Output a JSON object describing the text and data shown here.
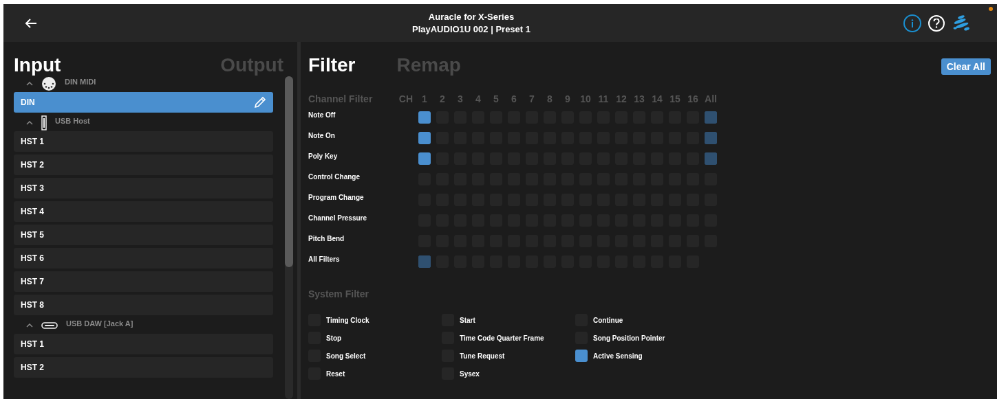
{
  "header": {
    "title": "Auracle for X-Series",
    "subtitle": "PlayAUDIO1U 002 | Preset 1",
    "notification_dot": true
  },
  "left_tabs": [
    {
      "label": "Input",
      "selected": true
    },
    {
      "label": "Output",
      "selected": false
    }
  ],
  "port_groups": [
    {
      "name": "DIN MIDI",
      "kind": "din",
      "expanded": true,
      "ports": [
        {
          "label": "DIN",
          "selected": true
        }
      ]
    },
    {
      "name": "USB Host",
      "kind": "usb_host",
      "expanded": true,
      "ports": [
        {
          "label": "HST 1",
          "selected": false
        },
        {
          "label": "HST 2",
          "selected": false
        },
        {
          "label": "HST 3",
          "selected": false
        },
        {
          "label": "HST 4",
          "selected": false
        },
        {
          "label": "HST 5",
          "selected": false
        },
        {
          "label": "HST 6",
          "selected": false
        },
        {
          "label": "HST 7",
          "selected": false
        },
        {
          "label": "HST 8",
          "selected": false
        }
      ]
    },
    {
      "name": "USB DAW [Jack A]",
      "kind": "usb_c",
      "expanded": true,
      "ports": [
        {
          "label": "HST 1",
          "selected": false
        },
        {
          "label": "HST 2",
          "selected": false
        }
      ]
    }
  ],
  "right_tabs": [
    {
      "label": "Filter",
      "selected": true
    },
    {
      "label": "Remap",
      "selected": false
    }
  ],
  "clear_button": "Clear All",
  "channel_filter": {
    "title": "Channel Filter",
    "ch_label": "CH",
    "columns": [
      "1",
      "2",
      "3",
      "4",
      "5",
      "6",
      "7",
      "8",
      "9",
      "10",
      "11",
      "12",
      "13",
      "14",
      "15",
      "16",
      "All"
    ],
    "rows": [
      {
        "label": "Note Off",
        "cells": [
          {
            "checked": true,
            "mixed": false
          },
          {
            "checked": false,
            "mixed": false
          },
          {
            "checked": false,
            "mixed": false
          },
          {
            "checked": false,
            "mixed": false
          },
          {
            "checked": false,
            "mixed": false
          },
          {
            "checked": false,
            "mixed": false
          },
          {
            "checked": false,
            "mixed": false
          },
          {
            "checked": false,
            "mixed": false
          },
          {
            "checked": false,
            "mixed": false
          },
          {
            "checked": false,
            "mixed": false
          },
          {
            "checked": false,
            "mixed": false
          },
          {
            "checked": false,
            "mixed": false
          },
          {
            "checked": false,
            "mixed": false
          },
          {
            "checked": false,
            "mixed": false
          },
          {
            "checked": false,
            "mixed": false
          },
          {
            "checked": false,
            "mixed": false
          },
          {
            "checked": false,
            "mixed": true
          }
        ]
      },
      {
        "label": "Note On",
        "cells": [
          {
            "checked": true,
            "mixed": false
          },
          {
            "checked": false,
            "mixed": false
          },
          {
            "checked": false,
            "mixed": false
          },
          {
            "checked": false,
            "mixed": false
          },
          {
            "checked": false,
            "mixed": false
          },
          {
            "checked": false,
            "mixed": false
          },
          {
            "checked": false,
            "mixed": false
          },
          {
            "checked": false,
            "mixed": false
          },
          {
            "checked": false,
            "mixed": false
          },
          {
            "checked": false,
            "mixed": false
          },
          {
            "checked": false,
            "mixed": false
          },
          {
            "checked": false,
            "mixed": false
          },
          {
            "checked": false,
            "mixed": false
          },
          {
            "checked": false,
            "mixed": false
          },
          {
            "checked": false,
            "mixed": false
          },
          {
            "checked": false,
            "mixed": false
          },
          {
            "checked": false,
            "mixed": true
          }
        ]
      },
      {
        "label": "Poly Key",
        "cells": [
          {
            "checked": true,
            "mixed": false
          },
          {
            "checked": false,
            "mixed": false
          },
          {
            "checked": false,
            "mixed": false
          },
          {
            "checked": false,
            "mixed": false
          },
          {
            "checked": false,
            "mixed": false
          },
          {
            "checked": false,
            "mixed": false
          },
          {
            "checked": false,
            "mixed": false
          },
          {
            "checked": false,
            "mixed": false
          },
          {
            "checked": false,
            "mixed": false
          },
          {
            "checked": false,
            "mixed": false
          },
          {
            "checked": false,
            "mixed": false
          },
          {
            "checked": false,
            "mixed": false
          },
          {
            "checked": false,
            "mixed": false
          },
          {
            "checked": false,
            "mixed": false
          },
          {
            "checked": false,
            "mixed": false
          },
          {
            "checked": false,
            "mixed": false
          },
          {
            "checked": false,
            "mixed": true
          }
        ]
      },
      {
        "label": "Control Change",
        "cells": [
          {
            "checked": false,
            "mixed": false
          },
          {
            "checked": false,
            "mixed": false
          },
          {
            "checked": false,
            "mixed": false
          },
          {
            "checked": false,
            "mixed": false
          },
          {
            "checked": false,
            "mixed": false
          },
          {
            "checked": false,
            "mixed": false
          },
          {
            "checked": false,
            "mixed": false
          },
          {
            "checked": false,
            "mixed": false
          },
          {
            "checked": false,
            "mixed": false
          },
          {
            "checked": false,
            "mixed": false
          },
          {
            "checked": false,
            "mixed": false
          },
          {
            "checked": false,
            "mixed": false
          },
          {
            "checked": false,
            "mixed": false
          },
          {
            "checked": false,
            "mixed": false
          },
          {
            "checked": false,
            "mixed": false
          },
          {
            "checked": false,
            "mixed": false
          },
          {
            "checked": false,
            "mixed": false
          }
        ]
      },
      {
        "label": "Program Change",
        "cells": [
          {
            "checked": false,
            "mixed": false
          },
          {
            "checked": false,
            "mixed": false
          },
          {
            "checked": false,
            "mixed": false
          },
          {
            "checked": false,
            "mixed": false
          },
          {
            "checked": false,
            "mixed": false
          },
          {
            "checked": false,
            "mixed": false
          },
          {
            "checked": false,
            "mixed": false
          },
          {
            "checked": false,
            "mixed": false
          },
          {
            "checked": false,
            "mixed": false
          },
          {
            "checked": false,
            "mixed": false
          },
          {
            "checked": false,
            "mixed": false
          },
          {
            "checked": false,
            "mixed": false
          },
          {
            "checked": false,
            "mixed": false
          },
          {
            "checked": false,
            "mixed": false
          },
          {
            "checked": false,
            "mixed": false
          },
          {
            "checked": false,
            "mixed": false
          },
          {
            "checked": false,
            "mixed": false
          }
        ]
      },
      {
        "label": "Channel Pressure",
        "cells": [
          {
            "checked": false,
            "mixed": false
          },
          {
            "checked": false,
            "mixed": false
          },
          {
            "checked": false,
            "mixed": false
          },
          {
            "checked": false,
            "mixed": false
          },
          {
            "checked": false,
            "mixed": false
          },
          {
            "checked": false,
            "mixed": false
          },
          {
            "checked": false,
            "mixed": false
          },
          {
            "checked": false,
            "mixed": false
          },
          {
            "checked": false,
            "mixed": false
          },
          {
            "checked": false,
            "mixed": false
          },
          {
            "checked": false,
            "mixed": false
          },
          {
            "checked": false,
            "mixed": false
          },
          {
            "checked": false,
            "mixed": false
          },
          {
            "checked": false,
            "mixed": false
          },
          {
            "checked": false,
            "mixed": false
          },
          {
            "checked": false,
            "mixed": false
          },
          {
            "checked": false,
            "mixed": false
          }
        ]
      },
      {
        "label": "Pitch Bend",
        "cells": [
          {
            "checked": false,
            "mixed": false
          },
          {
            "checked": false,
            "mixed": false
          },
          {
            "checked": false,
            "mixed": false
          },
          {
            "checked": false,
            "mixed": false
          },
          {
            "checked": false,
            "mixed": false
          },
          {
            "checked": false,
            "mixed": false
          },
          {
            "checked": false,
            "mixed": false
          },
          {
            "checked": false,
            "mixed": false
          },
          {
            "checked": false,
            "mixed": false
          },
          {
            "checked": false,
            "mixed": false
          },
          {
            "checked": false,
            "mixed": false
          },
          {
            "checked": false,
            "mixed": false
          },
          {
            "checked": false,
            "mixed": false
          },
          {
            "checked": false,
            "mixed": false
          },
          {
            "checked": false,
            "mixed": false
          },
          {
            "checked": false,
            "mixed": false
          },
          {
            "checked": false,
            "mixed": false
          }
        ]
      },
      {
        "label": "All Filters",
        "cells": [
          {
            "checked": false,
            "mixed": true
          },
          {
            "checked": false,
            "mixed": false
          },
          {
            "checked": false,
            "mixed": false
          },
          {
            "checked": false,
            "mixed": false
          },
          {
            "checked": false,
            "mixed": false
          },
          {
            "checked": false,
            "mixed": false
          },
          {
            "checked": false,
            "mixed": false
          },
          {
            "checked": false,
            "mixed": false
          },
          {
            "checked": false,
            "mixed": false
          },
          {
            "checked": false,
            "mixed": false
          },
          {
            "checked": false,
            "mixed": false
          },
          {
            "checked": false,
            "mixed": false
          },
          {
            "checked": false,
            "mixed": false
          },
          {
            "checked": false,
            "mixed": false
          },
          {
            "checked": false,
            "mixed": false
          },
          {
            "checked": false,
            "mixed": false
          }
        ]
      }
    ]
  },
  "system_filter": {
    "title": "System Filter",
    "items": [
      {
        "label": "Timing Clock",
        "checked": false
      },
      {
        "label": "Start",
        "checked": false
      },
      {
        "label": "Continue",
        "checked": false
      },
      {
        "label": "Stop",
        "checked": false
      },
      {
        "label": "Time Code Quarter Frame",
        "checked": false
      },
      {
        "label": "Song Position Pointer",
        "checked": false
      },
      {
        "label": "Song Select",
        "checked": false
      },
      {
        "label": "Tune Request",
        "checked": false
      },
      {
        "label": "Active Sensing",
        "checked": true
      },
      {
        "label": "Reset",
        "checked": false
      },
      {
        "label": "Sysex",
        "checked": false
      }
    ]
  }
}
